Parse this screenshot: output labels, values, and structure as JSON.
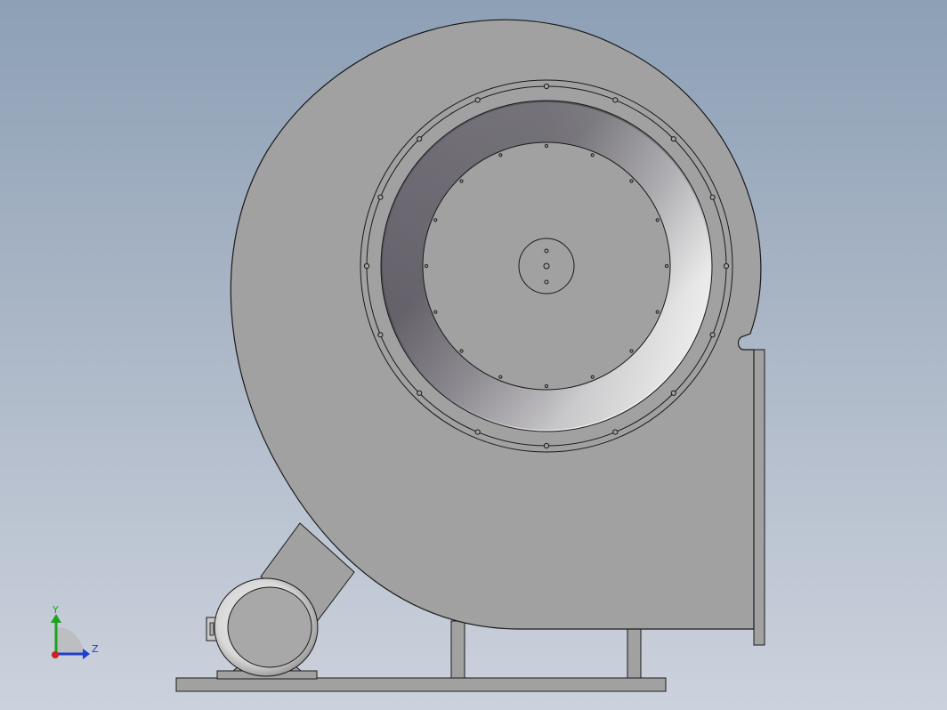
{
  "viewport": {
    "background_top": "#8da0b6",
    "background_bottom": "#ccd2dd"
  },
  "model": {
    "housing_color": "#a1a1a1",
    "outline_color": "#1a1a1a",
    "motor_color": "#d9d9d9"
  },
  "triad": {
    "y_label": "Y",
    "z_label": "Z",
    "y_color": "#22a022",
    "z_color": "#1f3fd0",
    "x_color": "#d02020"
  }
}
